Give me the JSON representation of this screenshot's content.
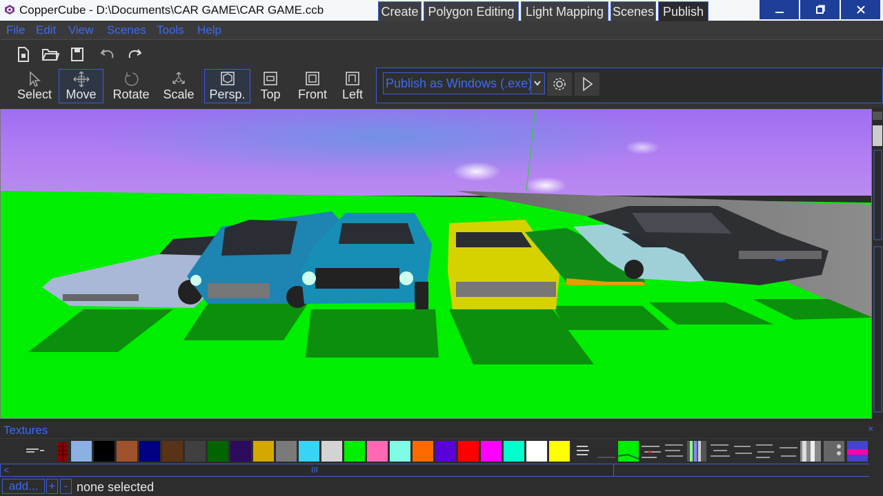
{
  "window": {
    "title": "CopperCube - D:\\Documents\\CAR GAME\\CAR GAME.ccb",
    "controls": [
      "minimize",
      "maximize",
      "close"
    ]
  },
  "menu": [
    "File",
    "Edit",
    "View",
    "Scenes",
    "Tools",
    "Help"
  ],
  "toolbar": {
    "file_buttons": [
      "new-file-icon",
      "open-folder-icon",
      "save-icon",
      "undo-icon",
      "redo-icon"
    ],
    "tools": [
      {
        "label": "Select",
        "icon": "cursor-arrow-icon",
        "selected": false
      },
      {
        "label": "Move",
        "icon": "move-arrows-icon",
        "selected": true
      },
      {
        "label": "Rotate",
        "icon": "rotate-icon",
        "selected": false
      },
      {
        "label": "Scale",
        "icon": "scale-icon",
        "selected": false
      }
    ],
    "views": [
      {
        "label": "Persp.",
        "icon": "perspective-cube-icon",
        "selected": true
      },
      {
        "label": "Top",
        "icon": "top-view-icon",
        "selected": false
      },
      {
        "label": "Front",
        "icon": "front-view-icon",
        "selected": false
      },
      {
        "label": "Left",
        "icon": "left-view-icon",
        "selected": false
      }
    ]
  },
  "tabs": {
    "items": [
      "Create",
      "Polygon Editing",
      "Light Mapping",
      "Scenes",
      "Publish"
    ],
    "active": "Publish"
  },
  "publish": {
    "target": "Publish as Windows (.exe)"
  },
  "textures": {
    "title": "Textures",
    "close": "×",
    "swatches": [
      "#8ab0e4",
      "#000000",
      "#a0522d",
      "#000080",
      "#5a3216",
      "#404040",
      "#006400",
      "#2c0b5e",
      "#d4a800",
      "#7a7a7a",
      "#38d4f7",
      "#d3d3d3",
      "#00ee00",
      "#ff69b4",
      "#7ffbe6",
      "#ff6a00",
      "#5a00d8",
      "#ff0000",
      "#ff00ff",
      "#00ffcc",
      "#ffffff",
      "#ffff00"
    ],
    "scroll_left": "<",
    "scroll_thumb": "III"
  },
  "bottom": {
    "add_label": "add...",
    "plus_label": "+",
    "minus_label": "-",
    "status": "none selected"
  },
  "colors": {
    "accent": "#3d6bf2",
    "ground": "#00ee00",
    "sky": "#a875f0"
  }
}
